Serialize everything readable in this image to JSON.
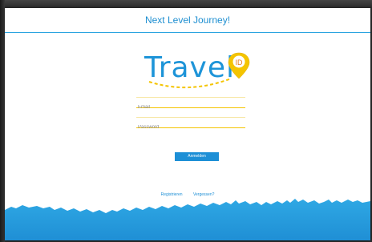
{
  "header": {
    "title": "Next Level Journey!"
  },
  "logo": {
    "text": "Travel",
    "badge_text": "ID"
  },
  "form": {
    "email_placeholder": "Email",
    "password_placeholder": "Password",
    "submit_label": "Anmelden"
  },
  "links": {
    "left": "Registrieren",
    "right": "Vergessen?"
  },
  "colors": {
    "accent": "#1d8fd6",
    "yellow": "#f4c400",
    "sky": "#29a3e0"
  }
}
